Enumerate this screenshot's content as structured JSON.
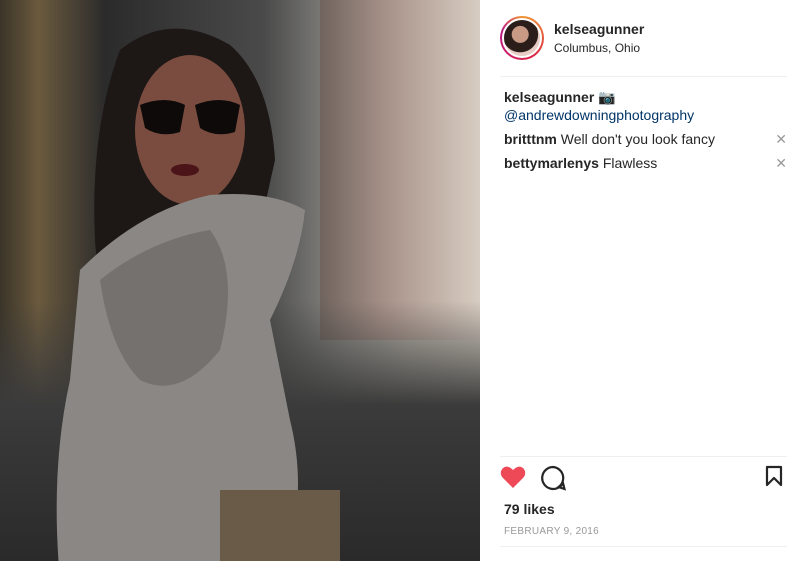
{
  "header": {
    "username": "kelseagunner",
    "location": "Columbus, Ohio"
  },
  "caption": {
    "author": "kelseagunner",
    "camera_emoji": "📷",
    "mention": "@andrewdowningphotography"
  },
  "comments": [
    {
      "author": "britttnm",
      "text": "Well don't you look fancy"
    },
    {
      "author": "bettymarlenys",
      "text": "Flawless"
    }
  ],
  "likes": "79 likes",
  "date": "FEBRUARY 9, 2016",
  "icons": {
    "like": "heart-icon",
    "comment": "comment-icon",
    "save": "bookmark-icon",
    "remove": "close-icon"
  },
  "colors": {
    "heart": "#ed4956",
    "link": "#003569"
  }
}
